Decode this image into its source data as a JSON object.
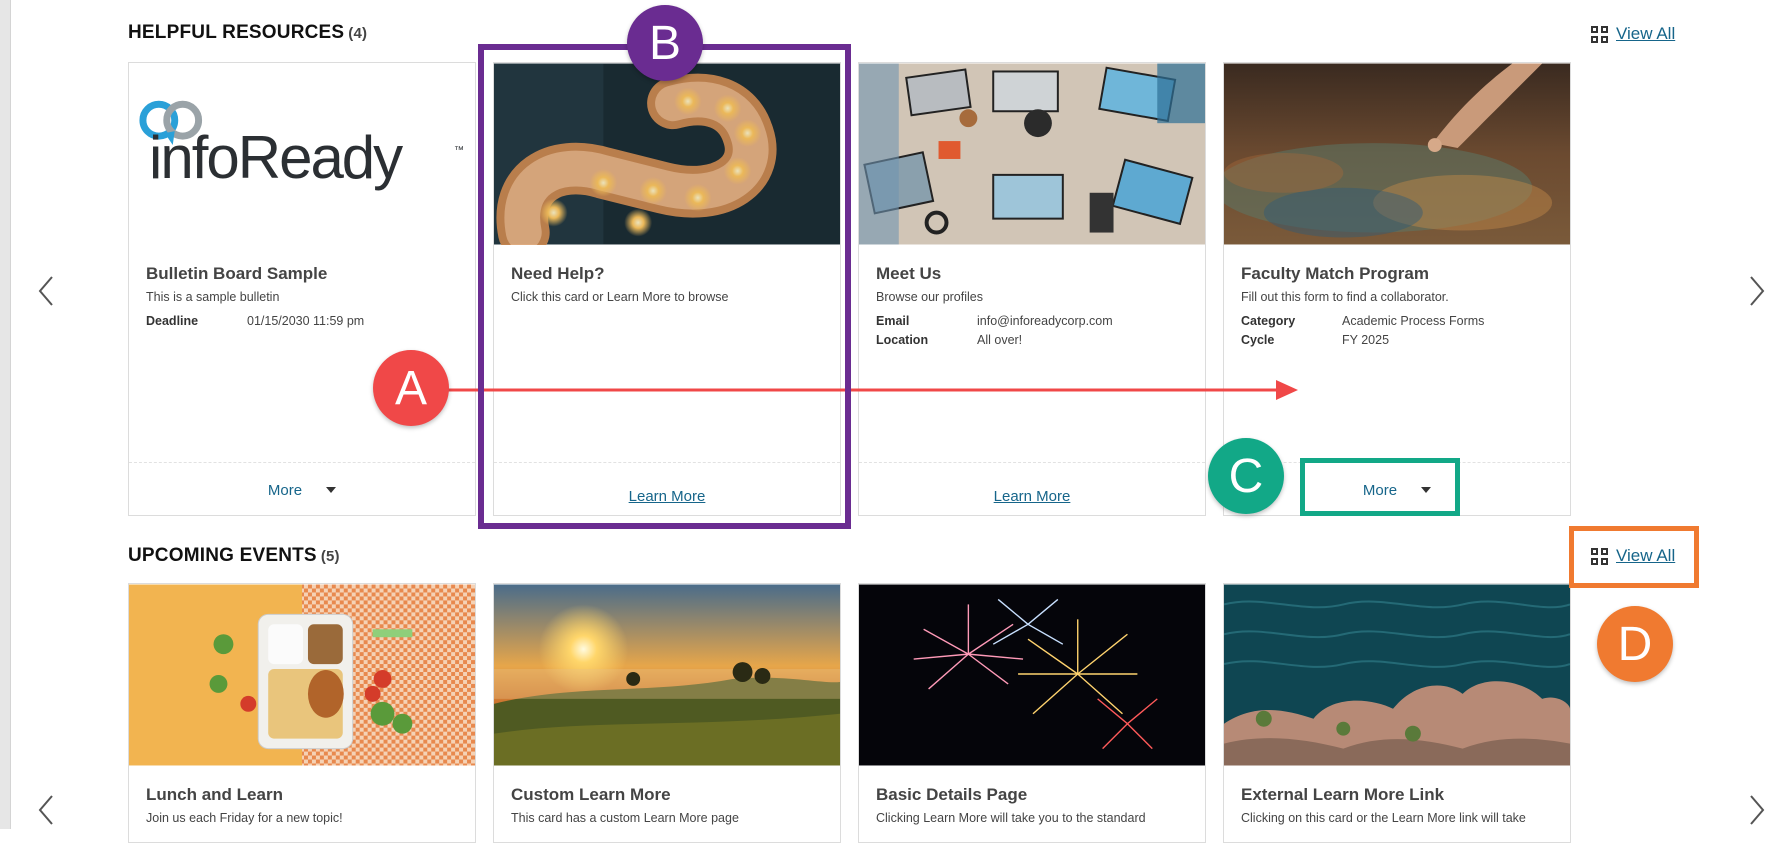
{
  "sections": {
    "resources": {
      "title": "HELPFUL RESOURCES",
      "count": "(4)",
      "view_all": "View All"
    },
    "events": {
      "title": "UPCOMING EVENTS",
      "count": "(5)",
      "view_all": "View All"
    }
  },
  "resource_cards": [
    {
      "logo": "infoReady",
      "logo_tm": "™",
      "title": "Bulletin Board Sample",
      "desc": "This is a sample bulletin",
      "meta": [
        {
          "k": "Deadline",
          "v": "01/15/2030 11:59 pm"
        }
      ],
      "footer": "More"
    },
    {
      "title": "Need Help?",
      "desc": "Click this card or Learn More to browse",
      "footer": "Learn More"
    },
    {
      "title": "Meet Us",
      "desc": "Browse our profiles",
      "meta": [
        {
          "k": "Email",
          "v": "info@inforeadycorp.com"
        },
        {
          "k": "Location",
          "v": "All over!"
        }
      ],
      "footer": "Learn More"
    },
    {
      "title": "Faculty Match Program",
      "desc": "Fill out this form to find a collaborator.",
      "meta": [
        {
          "k": "Category",
          "v": "Academic Process Forms"
        },
        {
          "k": "Cycle",
          "v": "FY 2025"
        }
      ],
      "footer": "More"
    }
  ],
  "event_cards": [
    {
      "title": "Lunch and Learn",
      "desc": "Join us each Friday for a new topic!"
    },
    {
      "title": "Custom Learn More",
      "desc": "This card has a custom Learn More page"
    },
    {
      "title": "Basic Details Page",
      "desc": "Clicking Learn More will take you to the standard"
    },
    {
      "title": "External Learn More Link",
      "desc": "Clicking on this card or the Learn More link will take"
    }
  ],
  "annotations": {
    "a": {
      "label": "A",
      "color": "#f04848"
    },
    "b": {
      "label": "B",
      "color": "#6a2c91"
    },
    "c": {
      "label": "C",
      "color": "#12a887"
    },
    "d": {
      "label": "D",
      "color": "#f07a30"
    }
  },
  "icons": [
    "chevron-left-icon",
    "chevron-right-icon",
    "grid-icon",
    "caret-down-icon"
  ]
}
